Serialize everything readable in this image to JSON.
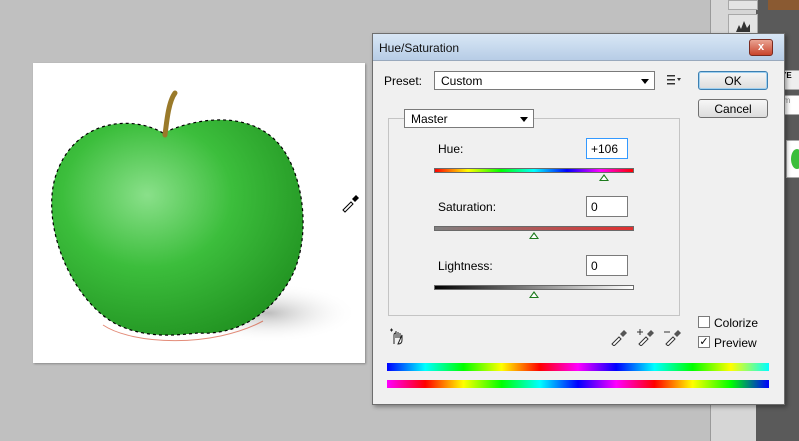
{
  "dialog": {
    "title": "Hue/Saturation",
    "close_glyph": "x",
    "preset_label": "Preset:",
    "preset_value": "Custom",
    "ok_label": "OK",
    "cancel_label": "Cancel",
    "channel_value": "Master",
    "hue": {
      "label": "Hue:",
      "value": "+106",
      "position": 0.85
    },
    "saturation": {
      "label": "Saturation:",
      "value": "0",
      "position": 0.5
    },
    "lightness": {
      "label": "Lightness:",
      "value": "0",
      "position": 0.5
    },
    "colorize_label": "Colorize",
    "colorize_checked": false,
    "preview_label": "Preview",
    "preview_checked": true,
    "preview_check_glyph": "✓"
  },
  "side_panel": {
    "tab_text": "YE",
    "field_text": "rm"
  },
  "icons": [
    "eyedropper-cursor-icon",
    "preset-options-icon",
    "targeted-adjustment-hand-icon",
    "eyedropper-icon",
    "eyedropper-plus-icon",
    "eyedropper-minus-icon",
    "chevron-down-icon",
    "close-icon"
  ],
  "colors": {
    "apple_green": "#3cbe3c",
    "ok_focus": "#3c7fb1",
    "slider_thumb": "#1d7a1d"
  }
}
